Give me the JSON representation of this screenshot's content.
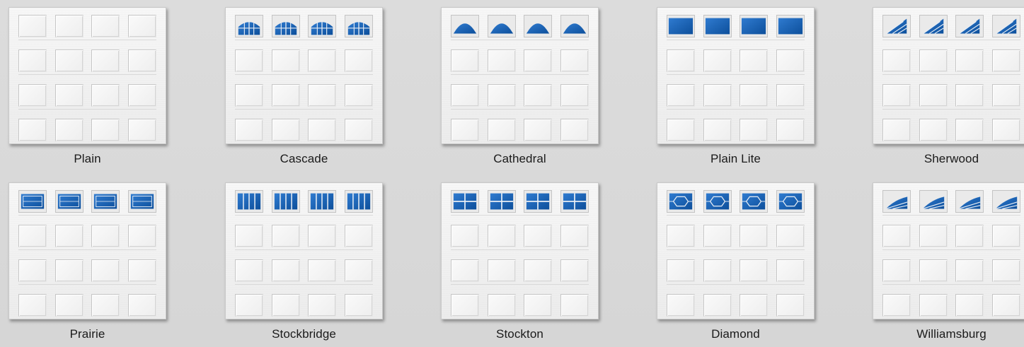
{
  "colors": {
    "background": "#d8d8d8",
    "door_white": "#f3f3f3",
    "glass_blue": "#0d4f9b",
    "glass_highlight": "#2f7bd0"
  },
  "doors": [
    {
      "name": "Plain",
      "window_style": "none",
      "window_icon": "no-window"
    },
    {
      "name": "Cascade",
      "window_style": "cascade",
      "window_icon": "arched-grid-window-icon"
    },
    {
      "name": "Cathedral",
      "window_style": "cathedral",
      "window_icon": "dome-window-icon"
    },
    {
      "name": "Plain Lite",
      "window_style": "plain-lite",
      "window_icon": "solid-glass-window-icon"
    },
    {
      "name": "Sherwood",
      "window_style": "sherwood",
      "window_icon": "fan-window-icon"
    },
    {
      "name": "Prairie",
      "window_style": "prairie",
      "window_icon": "prairie-grid-window-icon"
    },
    {
      "name": "Stockbridge",
      "window_style": "stockbridge",
      "window_icon": "vertical-bars-window-icon"
    },
    {
      "name": "Stockton",
      "window_style": "stockton",
      "window_icon": "cross-grid-window-icon"
    },
    {
      "name": "Diamond",
      "window_style": "diamond",
      "window_icon": "hexagon-window-icon"
    },
    {
      "name": "Williamsburg",
      "window_style": "williamsburg",
      "window_icon": "sunburst-window-icon"
    }
  ]
}
